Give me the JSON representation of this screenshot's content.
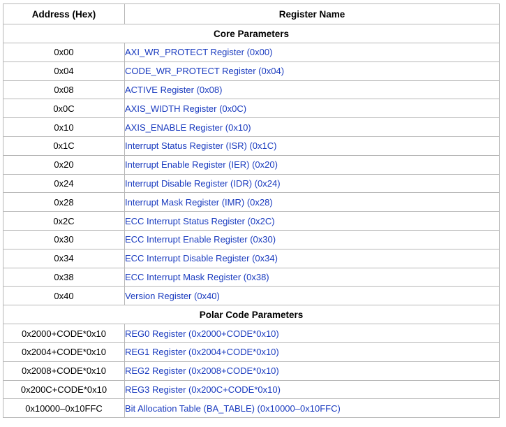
{
  "header": {
    "col_address": "Address (Hex)",
    "col_name": "Register Name"
  },
  "sections": [
    {
      "title": "Core Parameters",
      "rows": [
        {
          "address": "0x00",
          "name": "AXI_WR_PROTECT Register (0x00)"
        },
        {
          "address": "0x04",
          "name": "CODE_WR_PROTECT Register (0x04)"
        },
        {
          "address": "0x08",
          "name": "ACTIVE Register (0x08)"
        },
        {
          "address": "0x0C",
          "name": "AXIS_WIDTH Register (0x0C)"
        },
        {
          "address": "0x10",
          "name": "AXIS_ENABLE Register (0x10)"
        },
        {
          "address": "0x1C",
          "name": "Interrupt Status Register (ISR) (0x1C)"
        },
        {
          "address": "0x20",
          "name": "Interrupt Enable Register (IER) (0x20)"
        },
        {
          "address": "0x24",
          "name": "Interrupt Disable Register (IDR) (0x24)"
        },
        {
          "address": "0x28",
          "name": "Interrupt Mask Register (IMR) (0x28)"
        },
        {
          "address": "0x2C",
          "name": "ECC Interrupt Status Register (0x2C)"
        },
        {
          "address": "0x30",
          "name": "ECC Interrupt Enable Register (0x30)"
        },
        {
          "address": "0x34",
          "name": "ECC Interrupt Disable Register (0x34)"
        },
        {
          "address": "0x38",
          "name": "ECC Interrupt Mask Register (0x38)"
        },
        {
          "address": "0x40",
          "name": "Version Register (0x40)"
        }
      ]
    },
    {
      "title": "Polar Code Parameters",
      "rows": [
        {
          "address": "0x2000+CODE*0x10",
          "name": "REG0 Register (0x2000+CODE*0x10)"
        },
        {
          "address": "0x2004+CODE*0x10",
          "name": "REG1 Register (0x2004+CODE*0x10)"
        },
        {
          "address": "0x2008+CODE*0x10",
          "name": "REG2 Register (0x2008+CODE*0x10)"
        },
        {
          "address": "0x200C+CODE*0x10",
          "name": "REG3 Register (0x200C+CODE*0x10)"
        },
        {
          "address": "0x10000–0x10FFC",
          "name": "Bit Allocation Table (BA_TABLE) (0x10000–0x10FFC)"
        }
      ]
    }
  ],
  "colors": {
    "link": "#1a3bbf",
    "header_rule": "#b8143c",
    "border": "#b7b7b7"
  }
}
